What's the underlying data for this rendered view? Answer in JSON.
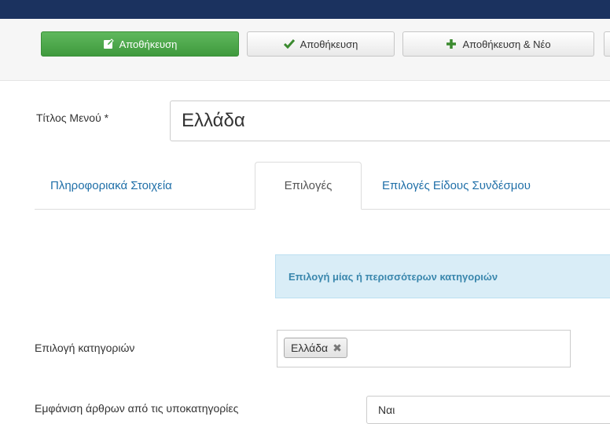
{
  "toolbar": {
    "save_primary_label": "Αποθήκευση",
    "save_label": "Αποθήκευση",
    "save_new_label": "Αποθήκευση & Νέο"
  },
  "form": {
    "title_label": "Τίτλος Μενού *",
    "title_value": "Ελλάδα"
  },
  "tabs": [
    {
      "label": "Πληροφοριακά Στοιχεία"
    },
    {
      "label": "Επιλογές"
    },
    {
      "label": "Επιλογές Είδους Συνδέσμου"
    }
  ],
  "info_box": {
    "text": "Επιλογή μίας ή περισσότερων κατηγοριών"
  },
  "category_field": {
    "label": "Επιλογή κατηγοριών",
    "selected": [
      "Ελλάδα"
    ]
  },
  "subcategory_field": {
    "label": "Εμφάνιση άρθρων από τις υποκατηγορίες",
    "value": "Ναι"
  },
  "colors": {
    "topbar": "#1b325f",
    "primary_button": "#4cae4c",
    "link": "#1f6fa8",
    "info_bg": "#d9edf7"
  },
  "icons": {
    "save_primary": "edit-icon",
    "save": "check-icon",
    "save_new": "plus-icon"
  }
}
